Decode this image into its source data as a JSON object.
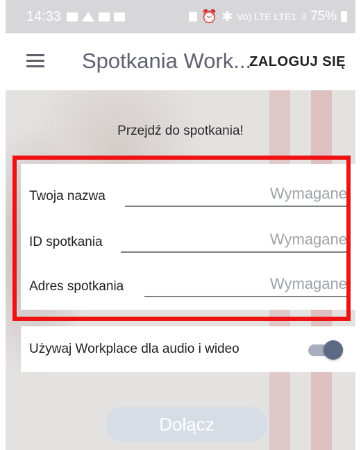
{
  "status_bar": {
    "time": "14:33",
    "network": "Vo) LTE LTE1 .il",
    "battery": "75%",
    "left_icons": [
      "chat-icon",
      "font-icon",
      "gallery-icon",
      "youtube-icon"
    ],
    "right_icons": [
      "lock-icon",
      "alarm-icon",
      "bluetooth-icon",
      "signal-icon",
      "battery-icon"
    ]
  },
  "app_bar": {
    "menu_icon": "hamburger-icon",
    "title": "Spotkania Work...",
    "login_label": "ZALOGUJ SIĘ"
  },
  "main": {
    "heading": "Przejdź do spotkania!",
    "fields": [
      {
        "label": "Twoja nazwa",
        "placeholder": "Wymagane",
        "value": ""
      },
      {
        "label": "ID spotkania",
        "placeholder": "Wymagane",
        "value": ""
      },
      {
        "label": "Adres spotkania",
        "placeholder": "Wymagane",
        "value": ""
      }
    ],
    "toggle": {
      "label": "Używaj Workplace dla audio i wideo",
      "state": "on"
    },
    "join_label": "Dołącz"
  },
  "colors": {
    "highlight": "#ee1212",
    "title_text": "#5e6170",
    "toggle_thumb": "#5d6a86",
    "join_button": "#d6dde5"
  }
}
